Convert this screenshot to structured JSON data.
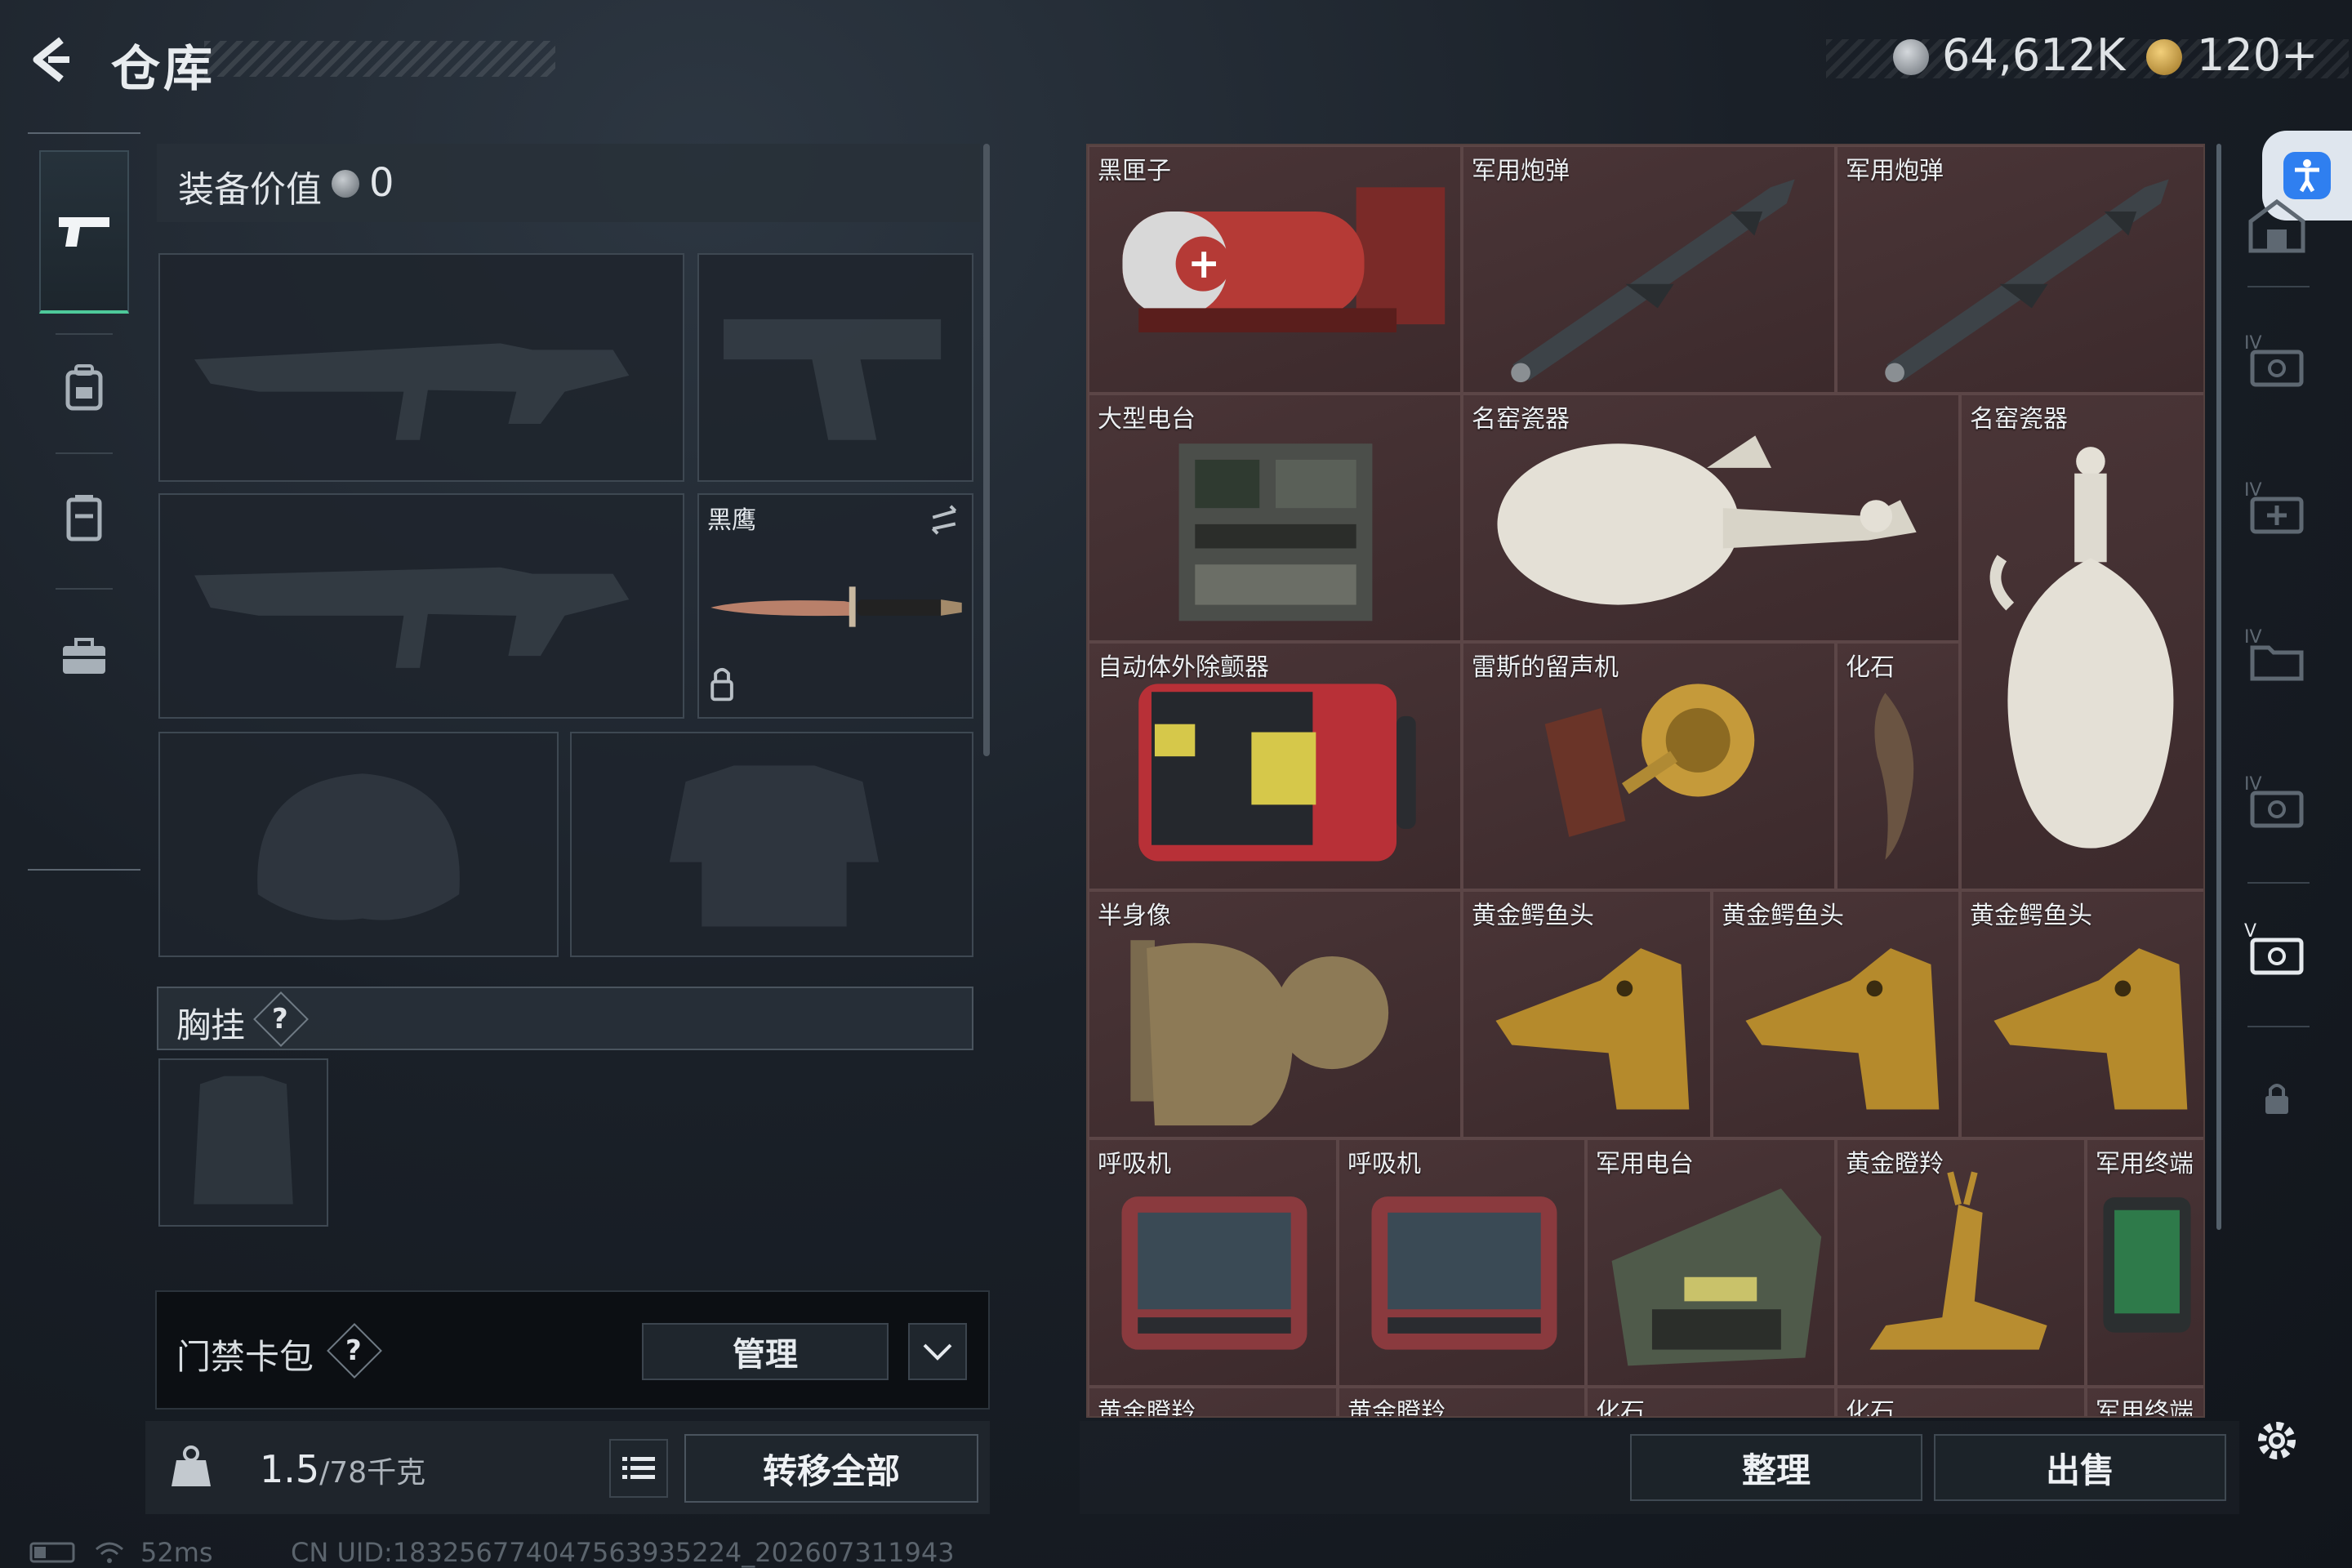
{
  "header": {
    "title": "仓库",
    "currency_silver": "64,612K",
    "currency_gold": "120+"
  },
  "loadout": {
    "equip_value_label": "装备价值",
    "equip_value": "0",
    "melee_name": "黑鹰",
    "chest_label": "胸挂",
    "help_mark": "?"
  },
  "keycard": {
    "label": "门禁卡包",
    "manage_label": "管理"
  },
  "capacity": {
    "weight_current": "1.5",
    "weight_max": "/78千克",
    "transfer_all_label": "转移全部"
  },
  "status": {
    "ping": "52ms",
    "uid": "CN UID:18325677404756393522​4_202607311943"
  },
  "stash": {
    "items": [
      {
        "name": "黑匣子",
        "icon": "black-box"
      },
      {
        "name": "军用炮弹",
        "icon": "military-shell"
      },
      {
        "name": "军用炮弹",
        "icon": "military-shell"
      },
      {
        "name": "大型电台",
        "icon": "large-radio"
      },
      {
        "name": "名窑瓷器",
        "icon": "porcelain-ewer"
      },
      {
        "name": "名窑瓷器",
        "icon": "porcelain-vase"
      },
      {
        "name": "自动体外除颤器",
        "icon": "aed"
      },
      {
        "name": "雷斯的留声机",
        "icon": "gramophone"
      },
      {
        "name": "化石",
        "icon": "fossil-claw"
      },
      {
        "name": "半身像",
        "icon": "bust"
      },
      {
        "name": "黄金鳄鱼头",
        "icon": "gold-croc-head"
      },
      {
        "name": "黄金鳄鱼头",
        "icon": "gold-croc-head"
      },
      {
        "name": "黄金鳄鱼头",
        "icon": "gold-croc-head"
      },
      {
        "name": "呼吸机",
        "icon": "ventilator"
      },
      {
        "name": "呼吸机",
        "icon": "ventilator"
      },
      {
        "name": "军用电台",
        "icon": "military-radio"
      },
      {
        "name": "黄金瞪羚",
        "icon": "gold-gazelle"
      },
      {
        "name": "军用终端",
        "icon": "military-terminal"
      },
      {
        "name": "黄金瞪羚",
        "icon": "partial"
      },
      {
        "name": "黄金瞪羚",
        "icon": "partial"
      },
      {
        "name": "化石",
        "icon": "partial"
      },
      {
        "name": "化石",
        "icon": "partial"
      },
      {
        "name": "军用终端",
        "icon": "partial"
      }
    ],
    "sort_label": "整理",
    "sell_label": "出售"
  },
  "colors": {
    "accent_green": "#4ec99a",
    "stash_bg": "#3f2d2e",
    "access_blue": "#2f7ff0"
  }
}
